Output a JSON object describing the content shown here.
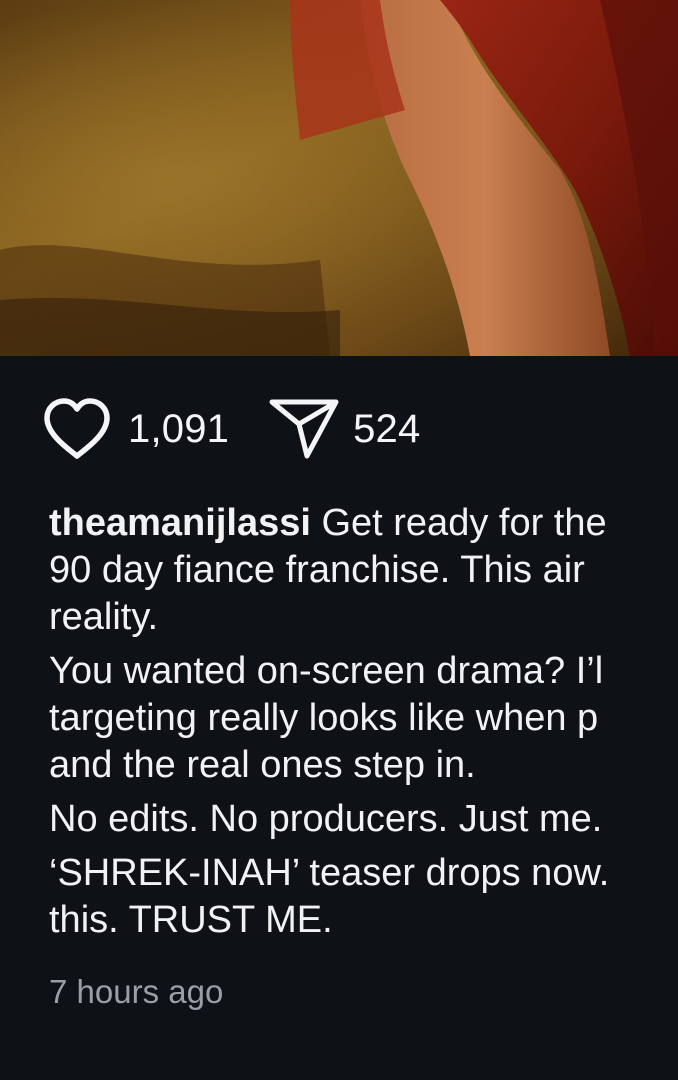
{
  "post": {
    "media": {
      "image": "photo of a person in a red dress"
    },
    "likes": "1,091",
    "shares": "524",
    "caption": {
      "username": "theamanijlassi",
      "line1_text": " Get ready for the",
      "line2": "90 day fiance franchise.  This air",
      "line3": "reality.",
      "line4": "You wanted on-screen drama? I’l",
      "line5": "targeting really looks like when p",
      "line6": "and the real ones step in.",
      "line7": "No edits. No producers. Just me.",
      "line8": "‘SHREK-INAH’ teaser drops now.",
      "line9": "this. TRUST ME."
    },
    "timestamp": "7 hours ago"
  },
  "icons": {
    "like": "heart-outline-icon",
    "share": "paper-plane-icon"
  },
  "colors": {
    "background": "#0e1116",
    "text": "#f5f5f7",
    "muted": "#9a9ea5"
  }
}
